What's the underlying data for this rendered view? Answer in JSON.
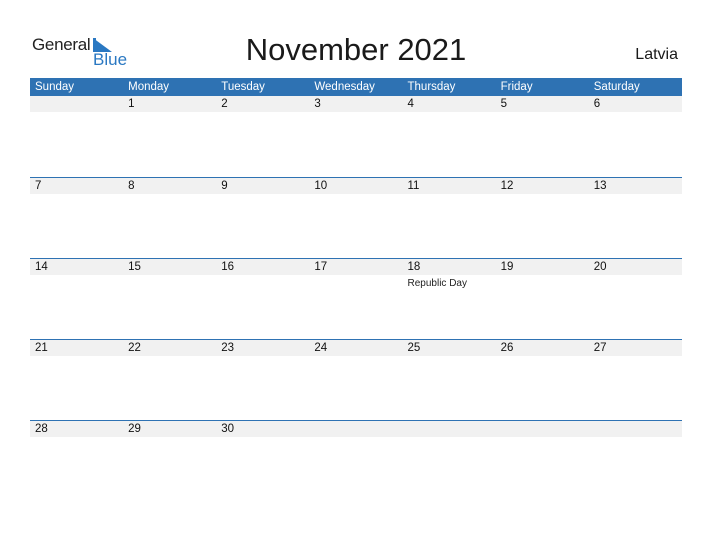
{
  "logo": {
    "word1": "General",
    "word2": "Blue",
    "accent_color": "#2a78c2"
  },
  "header": {
    "title": "November 2021",
    "country": "Latvia"
  },
  "calendar": {
    "header_color": "#2e72b3",
    "weekdays": [
      "Sunday",
      "Monday",
      "Tuesday",
      "Wednesday",
      "Thursday",
      "Friday",
      "Saturday"
    ],
    "weeks": [
      {
        "days": [
          "",
          "1",
          "2",
          "3",
          "4",
          "5",
          "6"
        ],
        "holidays": [
          "",
          "",
          "",
          "",
          "",
          "",
          ""
        ]
      },
      {
        "days": [
          "7",
          "8",
          "9",
          "10",
          "11",
          "12",
          "13"
        ],
        "holidays": [
          "",
          "",
          "",
          "",
          "",
          "",
          ""
        ]
      },
      {
        "days": [
          "14",
          "15",
          "16",
          "17",
          "18",
          "19",
          "20"
        ],
        "holidays": [
          "",
          "",
          "",
          "",
          "Republic Day",
          "",
          ""
        ]
      },
      {
        "days": [
          "21",
          "22",
          "23",
          "24",
          "25",
          "26",
          "27"
        ],
        "holidays": [
          "",
          "",
          "",
          "",
          "",
          "",
          ""
        ]
      },
      {
        "days": [
          "28",
          "29",
          "30",
          "",
          "",
          "",
          ""
        ],
        "holidays": [
          "",
          "",
          "",
          "",
          "",
          "",
          ""
        ]
      }
    ]
  }
}
